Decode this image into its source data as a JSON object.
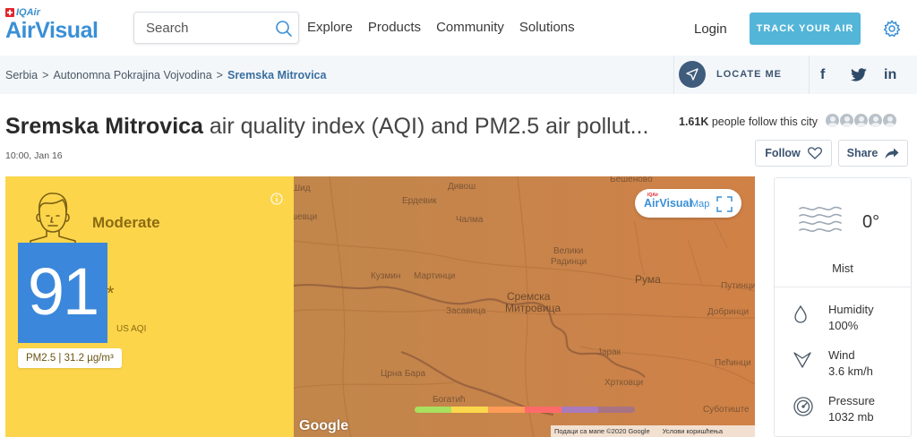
{
  "header": {
    "logo_top": "IQAir",
    "logo_main": "AirVisual",
    "search_placeholder": "Search",
    "nav": [
      "Explore",
      "Products",
      "Community",
      "Solutions"
    ],
    "login": "Login",
    "track_btn": "TRACK YOUR AIR"
  },
  "breadcrumb": {
    "items": [
      "Serbia",
      "Autonomna Pokrajina Vojvodina"
    ],
    "current": "Sremska Mitrovica",
    "locate_label": "LOCATE ME",
    "social": [
      "f",
      "t",
      "in"
    ]
  },
  "page": {
    "city": "Sremska Mitrovica",
    "title_rest": " air quality index (AQI) and PM2.5 air pollut...",
    "timestamp": "10:00, Jan 16",
    "followers": "1.61K",
    "followers_text": " people follow this city",
    "follow_btn": "Follow",
    "share_btn": "Share"
  },
  "aqi": {
    "level": "Moderate",
    "value": "91",
    "asterisk": "*",
    "unit": "US AQI",
    "pollutant": "PM2.5 | 31.2 µg/m³",
    "panel_color": "#fcd54b",
    "box_color": "#3b87db"
  },
  "map": {
    "badge_sub": "IQAir",
    "badge_brand": "AirVisual",
    "badge_word": "Map",
    "google": "Google",
    "attribution": "Подаци са мапе ©2020 Google",
    "terms": "Услови коришћења",
    "labels": [
      {
        "text": "Дивош",
        "cls": ""
      },
      {
        "text": "Ердевик",
        "cls": ""
      },
      {
        "text": "Чалма",
        "cls": ""
      },
      {
        "text": "Велики",
        "cls": ""
      },
      {
        "text": "Радинци",
        "cls": ""
      },
      {
        "text": "Кузмин",
        "cls": ""
      },
      {
        "text": "Мартинци",
        "cls": ""
      },
      {
        "text": "Сремска",
        "cls": "big"
      },
      {
        "text": "Митровица",
        "cls": "big"
      },
      {
        "text": "Засавица",
        "cls": ""
      },
      {
        "text": "Рума",
        "cls": "big"
      },
      {
        "text": "Путинци",
        "cls": ""
      },
      {
        "text": "Добринци",
        "cls": ""
      },
      {
        "text": "Јарак",
        "cls": ""
      },
      {
        "text": "Хртковци",
        "cls": ""
      },
      {
        "text": "Црна Бара",
        "cls": ""
      },
      {
        "text": "Богатић",
        "cls": ""
      },
      {
        "text": "Пећинци",
        "cls": ""
      },
      {
        "text": "Суботиште",
        "cls": ""
      },
      {
        "text": "шевци",
        "cls": ""
      },
      {
        "text": "Шид",
        "cls": ""
      },
      {
        "text": "Бешеновo",
        "cls": ""
      }
    ],
    "scale_colors": [
      "#a8e05f",
      "#fdd74b",
      "#fe9b57",
      "#fe6a69",
      "#a97abc",
      "#a87383"
    ]
  },
  "weather": {
    "temp": "0°",
    "condition": "Mist",
    "humidity_label": "Humidity",
    "humidity_value": "100%",
    "wind_label": "Wind",
    "wind_value": "3.6 km/h",
    "pressure_label": "Pressure",
    "pressure_value": "1032 mb"
  }
}
